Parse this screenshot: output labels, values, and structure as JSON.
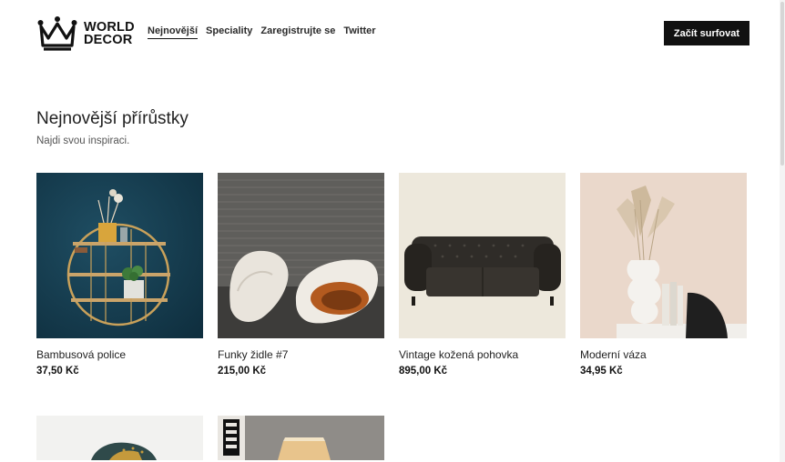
{
  "brand": {
    "line1": "WORLD",
    "line2": "DECOR",
    "icon": "crown-icon"
  },
  "nav": [
    {
      "label": "Nejnovější",
      "active": true
    },
    {
      "label": "Speciality",
      "active": false
    },
    {
      "label": "Zaregistrujte se",
      "active": false
    },
    {
      "label": "Twitter",
      "active": false
    }
  ],
  "cta_label": "Začít surfovat",
  "section": {
    "title": "Nejnovější přírůstky",
    "subtitle": "Najdi svou inspiraci."
  },
  "products": [
    {
      "name": "Bambusová police",
      "price": "37,50 Kč",
      "image": "bamboo-shelf-image"
    },
    {
      "name": "Funky židle #7",
      "price": "215,00 Kč",
      "image": "funky-chairs-image"
    },
    {
      "name": "Vintage kožená pohovka",
      "price": "895,00 Kč",
      "image": "leather-sofa-image"
    },
    {
      "name": "Moderní váza",
      "price": "34,95 Kč",
      "image": "modern-vase-image"
    }
  ],
  "products_row2": [
    {
      "image": "armchair-image"
    },
    {
      "image": "lamp-image"
    }
  ],
  "colors": {
    "accent": "#111111",
    "background": "#ffffff"
  }
}
